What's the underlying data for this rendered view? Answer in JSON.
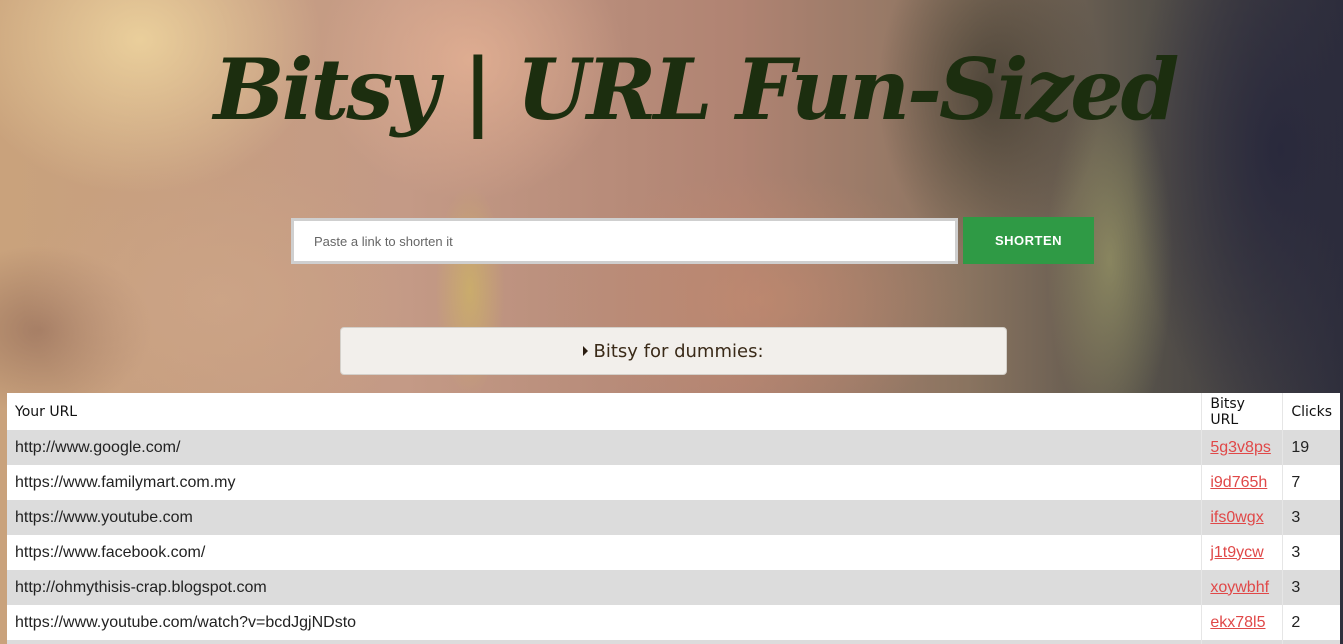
{
  "header": {
    "title": "Bitsy | URL Fun-Sized"
  },
  "search": {
    "placeholder": "Paste a link to shorten it",
    "value": "",
    "button_label": "SHORTEN"
  },
  "accordion": {
    "label": "Bitsy for dummies:"
  },
  "table": {
    "columns": [
      "Your URL",
      "Bitsy URL",
      "Clicks"
    ],
    "rows": [
      {
        "url": "http://www.google.com/",
        "bitsy": "5g3v8ps",
        "clicks": "19"
      },
      {
        "url": "https://www.familymart.com.my",
        "bitsy": "i9d765h",
        "clicks": "7"
      },
      {
        "url": "https://www.youtube.com",
        "bitsy": "ifs0wgx",
        "clicks": "3"
      },
      {
        "url": "https://www.facebook.com/",
        "bitsy": "j1t9ycw",
        "clicks": "3"
      },
      {
        "url": "http://ohmythisis-crap.blogspot.com",
        "bitsy": "xoywbhf",
        "clicks": "3"
      },
      {
        "url": "https://www.youtube.com/watch?v=bcdJgjNDsto",
        "bitsy": "ekx78l5",
        "clicks": "2"
      },
      {
        "url": "",
        "bitsy": "",
        "clicks": ""
      }
    ]
  },
  "colors": {
    "title": "#1c2e0f",
    "button": "#2f9a45",
    "link": "#e04848",
    "row_stripe": "#dcdcdc"
  }
}
